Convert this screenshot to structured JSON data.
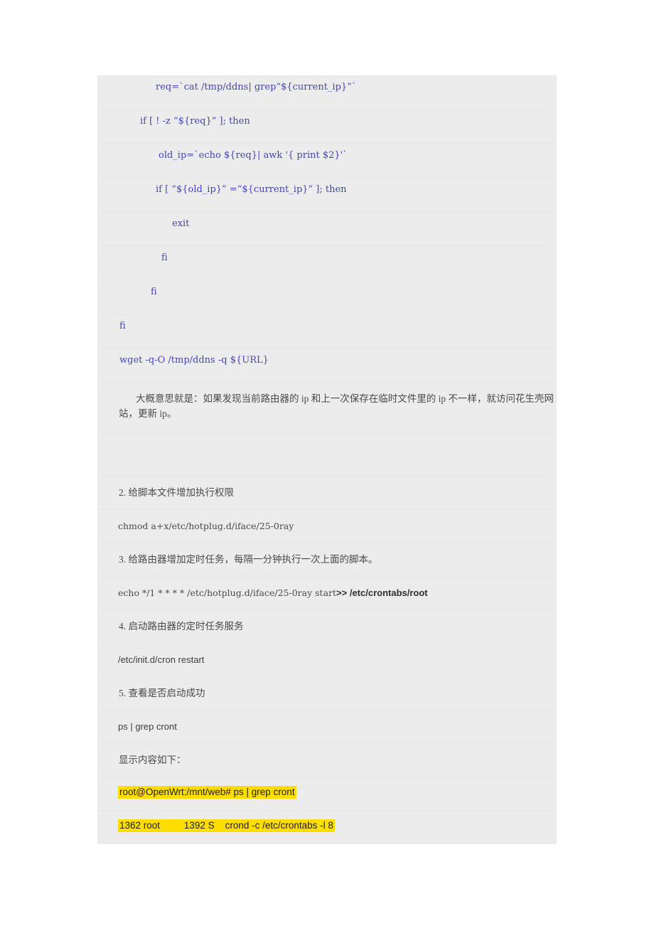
{
  "document": {
    "code_block": {
      "lines": [
        {
          "id": "l1",
          "text": "req=`cat /tmp/ddns| grep“${current_ip}”`",
          "indent": "ind3"
        },
        {
          "id": "l2",
          "text": "if [ ! -z “${req}” ]; then",
          "indent": "ind2"
        },
        {
          "id": "l3",
          "text": "old_ip=`echo ${req}| awk '{ print $2}'`",
          "indent": "ind4"
        },
        {
          "id": "l4",
          "text": "if [ “${old_ip}” =“${current_ip}” ]; then",
          "indent": "ind3"
        },
        {
          "id": "l5",
          "text": "exit",
          "indent": "ind5"
        },
        {
          "id": "l6",
          "text": "fi",
          "indent": "ind6"
        },
        {
          "id": "l7",
          "text": "fi",
          "indent": "ind7"
        },
        {
          "id": "l8",
          "text": "fi",
          "indent": "ind8"
        },
        {
          "id": "l9",
          "text": "wget -q-O /tmp/ddns -q ${URL}",
          "indent": "ind8"
        }
      ]
    },
    "summary_paragraph": {
      "text": "大概意思就是：如果发现当前路由器的 ip 和上一次保存在临时文件里的 ip 不一样，就访问花生壳网站，更新 ip。"
    },
    "steps": [
      {
        "id": "step2",
        "heading": "2. 给脚本文件增加执行权限",
        "command": "chmod a+x/etc/hotplug.d/iface/25-0ray",
        "command_style": "mono"
      },
      {
        "id": "step3",
        "heading": "3. 给路由器增加定时任务，每隔一分钟执行一次上面的脚本。",
        "command_prefix": "echo */1 * * * * /etc/hotplug.d/iface/25-0ray start",
        "command_bold": ">> /etc/crontabs/root",
        "command_style": "mono-split"
      },
      {
        "id": "step4",
        "heading": "4. 启动路由器的定时任务服务",
        "command": "/etc/init.d/cron restart",
        "command_style": "sans"
      },
      {
        "id": "step5",
        "heading": "5. 查看是否启动成功",
        "command": "ps | grep cront",
        "command_style": "sans"
      }
    ],
    "output_label": "显示内容如下：",
    "output_lines": [
      {
        "id": "out1",
        "text": "root@OpenWrt:/mnt/web# ps | grep cront"
      },
      {
        "id": "out2",
        "text": "1362 root         1392 S    crond -c /etc/crontabs -l 8"
      }
    ],
    "colors": {
      "page_background": "#ffffff",
      "block_background": "#ececec",
      "code_text": "#4444bb",
      "body_text": "#4a4a4a",
      "highlight_background": "#ffdd00",
      "highlight_text": "#1e1e1e",
      "separator": "#e7e7e7"
    }
  }
}
